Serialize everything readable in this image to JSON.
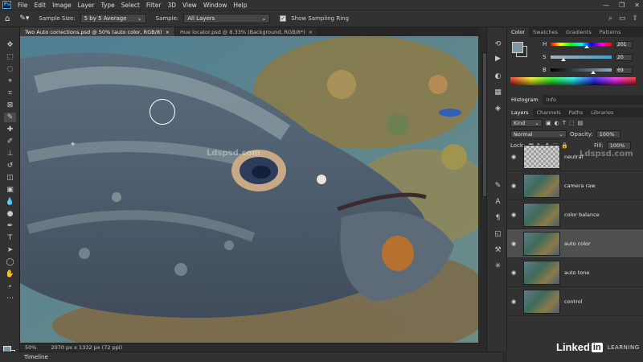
{
  "menubar": {
    "logo": "Ps",
    "items": [
      "File",
      "Edit",
      "Image",
      "Layer",
      "Type",
      "Select",
      "Filter",
      "3D",
      "View",
      "Window",
      "Help"
    ],
    "window_controls": [
      "—",
      "❐",
      "✕"
    ]
  },
  "options": {
    "sample_size_label": "Sample Size:",
    "sample_size_value": "5 by 5 Average",
    "sample_label": "Sample:",
    "sample_value": "All Layers",
    "show_ring_label": "Show Sampling Ring",
    "show_ring_checked": true
  },
  "doc_tabs": [
    {
      "title": "Two Auto corrections.psd @ 50% (auto color, RGB/8)",
      "active": true
    },
    {
      "title": "Hue locator.psd @ 8.33% (Background, RGB/8*)",
      "active": false
    }
  ],
  "status": {
    "zoom": "50%",
    "doc_size": "2070 px x 1332 px (72 ppi)"
  },
  "timeline_label": "Timeline",
  "color_panel": {
    "tabs": [
      "Color",
      "Swatches",
      "Gradients",
      "Patterns"
    ],
    "fg_color": "#7e97a3",
    "bg_color": "#2e2e2e",
    "channels": [
      {
        "label": "H",
        "value": "201"
      },
      {
        "label": "S",
        "value": "20"
      },
      {
        "label": "B",
        "value": "69"
      }
    ]
  },
  "histogram_tabs": [
    "Histogram",
    "Info"
  ],
  "layers_panel": {
    "tabs": [
      "Layers",
      "Channels",
      "Paths",
      "Libraries"
    ],
    "filter_kind": "Kind",
    "blend_mode": "Normal",
    "opacity_label": "Opacity:",
    "opacity_value": "100%",
    "lock_label": "Lock:",
    "fill_label": "Fill:",
    "fill_value": "100%",
    "layers": [
      {
        "name": "neutral",
        "selected": false,
        "thumb": "transparent"
      },
      {
        "name": "camera raw",
        "selected": false,
        "thumb": "photo"
      },
      {
        "name": "color balance",
        "selected": false,
        "thumb": "photo"
      },
      {
        "name": "auto color",
        "selected": true,
        "thumb": "photo"
      },
      {
        "name": "auto tone",
        "selected": false,
        "thumb": "photo"
      },
      {
        "name": "control",
        "selected": false,
        "thumb": "photo"
      }
    ]
  },
  "watermarks": [
    "Ldspsd.com",
    "Ldspsd.com"
  ],
  "branding": {
    "linkedin_text": "Linked",
    "linkedin_box": "in",
    "learning": "LEARNING"
  }
}
